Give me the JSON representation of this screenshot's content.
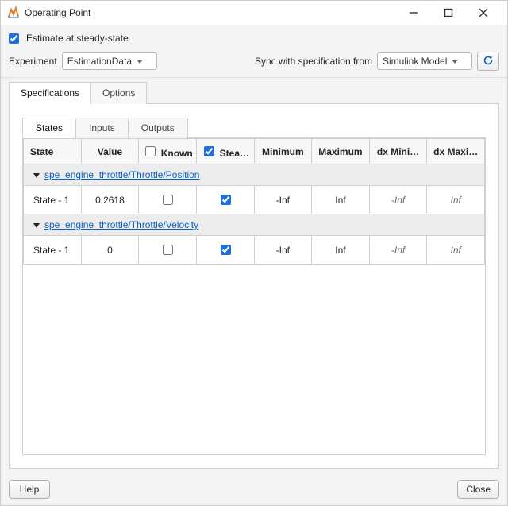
{
  "window": {
    "title": "Operating Point"
  },
  "top": {
    "estimate_checkbox_label": "Estimate at steady-state",
    "estimate_checked": true,
    "experiment_label": "Experiment",
    "experiment_value": "EstimationData",
    "sync_label": "Sync with specification from",
    "sync_value": "Simulink Model"
  },
  "outer_tabs": {
    "specifications": "Specifications",
    "options": "Options",
    "active": "specifications"
  },
  "inner_tabs": {
    "states": "States",
    "inputs": "Inputs",
    "outputs": "Outputs",
    "active": "states"
  },
  "columns": {
    "state": "State",
    "value": "Value",
    "known": "Known",
    "steady": "Stea…",
    "minimum": "Minimum",
    "maximum": "Maximum",
    "dxmin": "dx Mini…",
    "dxmax": "dx Maxi…",
    "known_header_checked": false,
    "steady_header_checked": true
  },
  "groups": [
    {
      "path": "spe_engine_throttle/Throttle/Position",
      "rows": [
        {
          "name": "State - 1",
          "value": "0.2618",
          "known": false,
          "steady": true,
          "minimum": "-Inf",
          "maximum": "Inf",
          "dxmin": "-Inf",
          "dxmax": "Inf"
        }
      ]
    },
    {
      "path": "spe_engine_throttle/Throttle/Velocity",
      "rows": [
        {
          "name": "State - 1",
          "value": "0",
          "known": false,
          "steady": true,
          "minimum": "-Inf",
          "maximum": "Inf",
          "dxmin": "-Inf",
          "dxmax": "Inf"
        }
      ]
    }
  ],
  "footer": {
    "help": "Help",
    "close": "Close"
  }
}
